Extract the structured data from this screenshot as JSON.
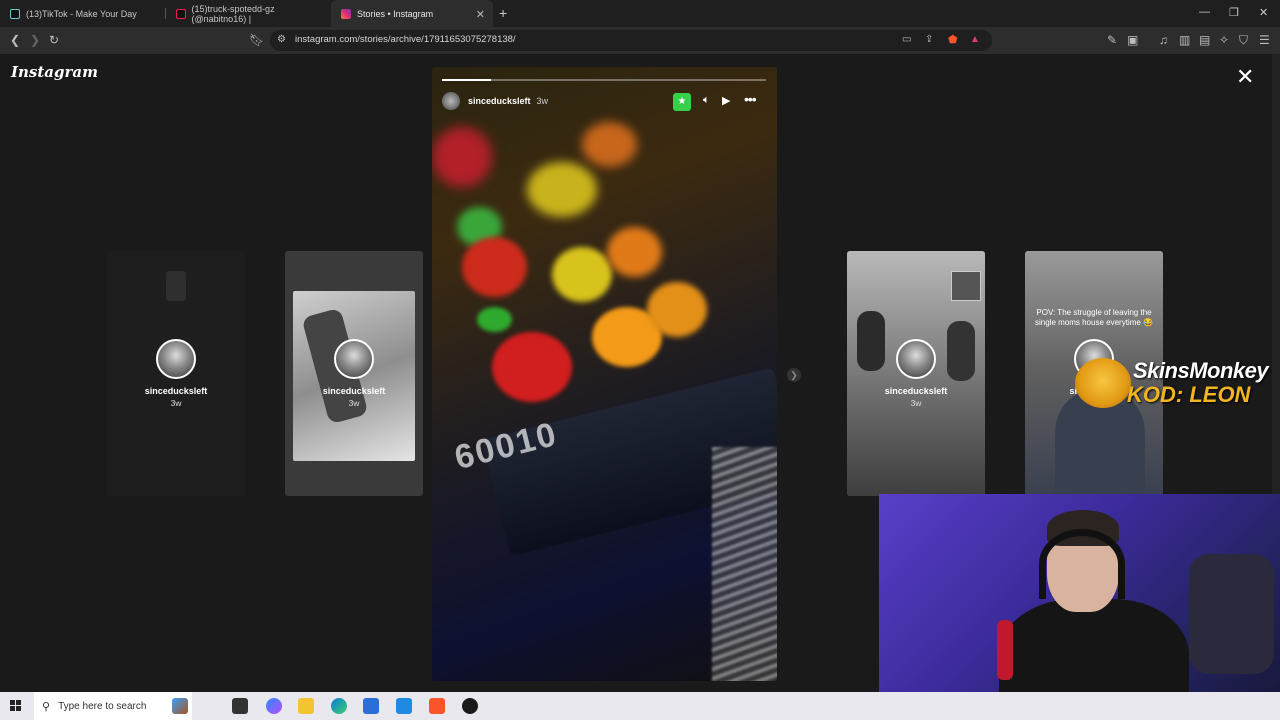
{
  "browser": {
    "tabs": [
      {
        "label": "(13)TikTok - Make Your Day",
        "close": ""
      },
      {
        "label": "(15)truck-spotedd-gz (@nabitno16) |",
        "close": ""
      },
      {
        "label": "Stories • Instagram",
        "close": "✕"
      }
    ],
    "new_tab": "+",
    "url": "instagram.com/stories/archive/17911653075278138/",
    "window_controls": [
      "—",
      "❐",
      "✕"
    ]
  },
  "instagram": {
    "logo": "Instagram",
    "close": "✕",
    "main_story": {
      "username": "sinceducksleft",
      "time": "3w",
      "progress": 0.15,
      "reel_text": "60010",
      "more": "•••"
    },
    "side_stories": [
      {
        "username": "sinceducksleft",
        "time": "3w"
      },
      {
        "username": "sinceducksleft",
        "time": "3w"
      },
      {
        "username": "sinceducksleft",
        "time": "3w"
      },
      {
        "username": "sinceducks",
        "time": "",
        "caption": "POV: The struggle of leaving the single moms house everytime 😂"
      }
    ]
  },
  "overlay": {
    "sponsor_line1": "SkinsMonkey",
    "sponsor_line2": "KOD: LEON"
  },
  "taskbar": {
    "search_placeholder": "Type here to search"
  }
}
